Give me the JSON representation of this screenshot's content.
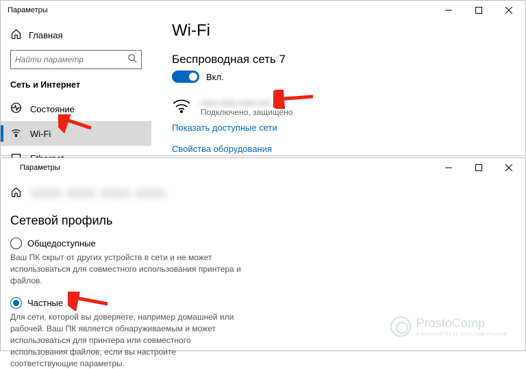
{
  "top": {
    "title": "Параметры",
    "home": "Главная",
    "search_placeholder": "Найти параметр",
    "category": "Сеть и Интернет",
    "nav": {
      "status": "Состояние",
      "wifi": "Wi-Fi",
      "ethernet": "Ethernet"
    },
    "page_title": "Wi-Fi",
    "wireless_heading": "Беспроводная сеть 7",
    "toggle_label": "Вкл.",
    "network_name": "xxxx-xxxx-xxxx-xxx",
    "network_status": "Подключено, защищено",
    "link_show": "Показать доступные сети",
    "link_hw": "Свойства оборудования"
  },
  "bottom": {
    "title": "Параметры",
    "back_label": "xxxx xxxx xxxx xxxx",
    "profile_heading": "Сетевой профиль",
    "public_label": "Общедоступные",
    "public_desc": "Ваш ПК скрыт от других устройств в сети и не может использоваться для совместного использования принтера и файлов.",
    "private_label": "Частные",
    "private_desc": "Для сети, которой вы доверяете, например домашней или рабочей. Ваш ПК является обнаруживаемым и может использоваться для принтера или совместного использования файлов, если вы настроите соответствующие параметры."
  },
  "watermark": {
    "brand": "ProstoComp",
    "brand_accent": "Comp",
    "tag": "о компьютерах простым языком"
  }
}
